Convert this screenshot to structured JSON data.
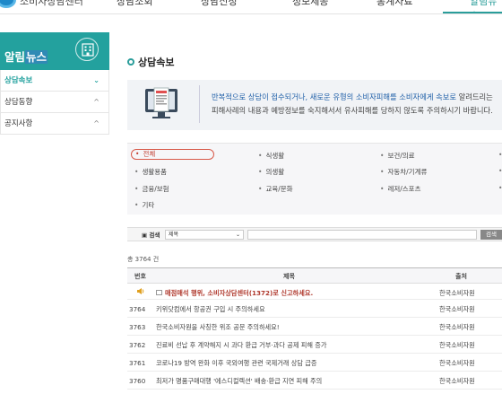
{
  "header": {
    "logo_text": "소비자상담센터",
    "nav": [
      "상담조회",
      "상담신청",
      "정보제공",
      "통계자료",
      "알림뉴스"
    ],
    "active_index": 4
  },
  "sidebar": {
    "title_prefix": "알림",
    "title_highlight": "뉴스",
    "items": [
      {
        "label": "상담속보",
        "chevron": "⌄",
        "active": true
      },
      {
        "label": "상담동향",
        "chevron": "^",
        "active": false
      },
      {
        "label": "공지사항",
        "chevron": "^",
        "active": false
      }
    ]
  },
  "main": {
    "page_title": "상담속보",
    "info": {
      "line1_em": "반복적으로 상담이 접수되거나, 새로운 유형의 소비자피해를 소비자에게 속보로",
      "line1_rest": " 알려드리는",
      "line2": "피해사례의 내용과 예방정보를 숙지해서서 유사피해를 당하지 않도록 주의하시기 바랍니다."
    },
    "categories": [
      {
        "label": "전체",
        "selected": true
      },
      {
        "label": "식생활",
        "selected": false
      },
      {
        "label": "보건/의료",
        "selected": false
      },
      {
        "label": "생활용품",
        "selected": false
      },
      {
        "label": "의생활",
        "selected": false
      },
      {
        "label": "자동차/기계류",
        "selected": false
      },
      {
        "label": "금융/보험",
        "selected": false
      },
      {
        "label": "교육/문화",
        "selected": false
      },
      {
        "label": "레저/스포츠",
        "selected": false
      },
      {
        "label": "기타",
        "selected": false
      }
    ],
    "search": {
      "label": "검색",
      "field_value": "제목",
      "input_value": "",
      "button": "검색"
    },
    "total_text": "총 3764 건",
    "table": {
      "headers": {
        "no": "번호",
        "title": "제목",
        "source": "출처"
      },
      "notice": {
        "title": "매점매석 행위, 소비자상담센터(1372)로 신고하세요.",
        "source": "한국소비자원"
      },
      "rows": [
        {
          "no": "3764",
          "title": "키위닷컴에서 항공권 구입 시 주의하세요",
          "source": "한국소비자원"
        },
        {
          "no": "3763",
          "title": "한국소비자원을 사칭한 위조 공문 주의하세요!",
          "source": "한국소비자원"
        },
        {
          "no": "3762",
          "title": "진료비 선납 후 계약해지 시 과다 환급 거부·과다 공제 피해 증가",
          "source": "한국소비자원"
        },
        {
          "no": "3761",
          "title": "코로나19 방역 완화 이후 국외여행 관련 국제거래 상담 급증",
          "source": "한국소비자원"
        },
        {
          "no": "3760",
          "title": "최저가 명품구매대행 '에스디컬렉션' 배송·환급 지연 피해 주의",
          "source": "한국소비자원"
        }
      ]
    }
  },
  "colors": {
    "accent": "#23a19e",
    "notice": "#b03a2e",
    "link": "#1f5fa8"
  }
}
